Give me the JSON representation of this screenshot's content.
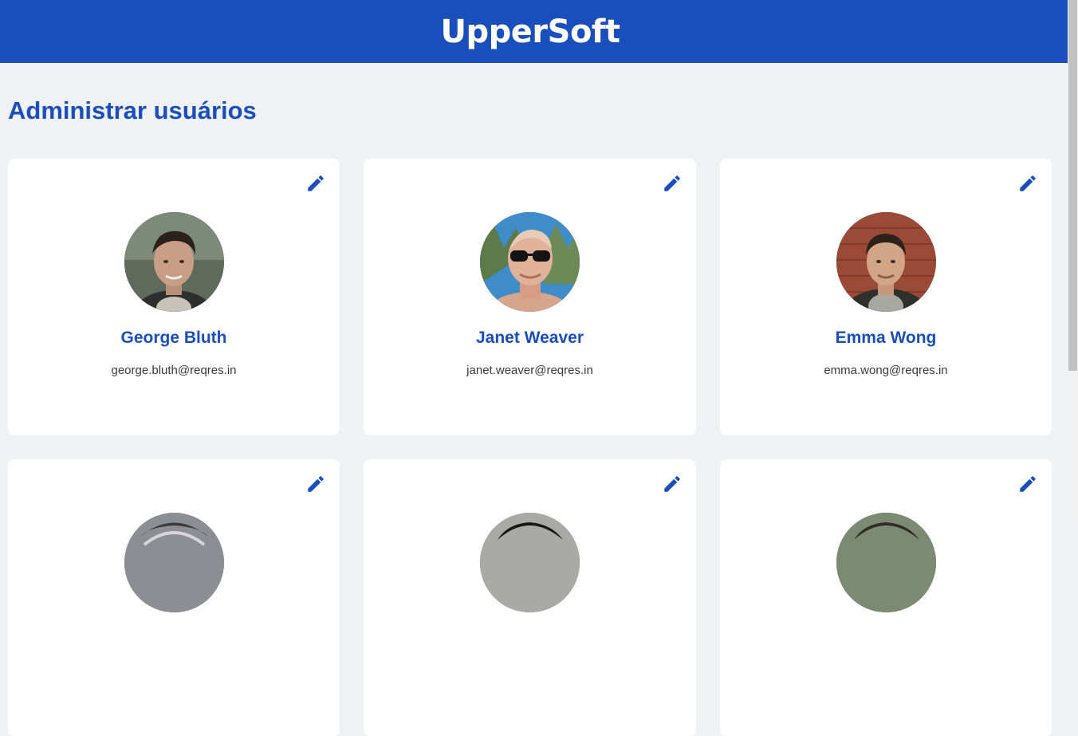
{
  "app": {
    "logo": "UpperSoft"
  },
  "colors": {
    "brand": "#1a4ebd",
    "background": "#f0f1f3",
    "card": "#ffffff"
  },
  "page": {
    "title": "Administrar usuários"
  },
  "users": [
    {
      "name": "George Bluth",
      "email": "george.bluth@reqres.in",
      "edit_icon": "pencil-icon",
      "avatar": "user-photo"
    },
    {
      "name": "Janet Weaver",
      "email": "janet.weaver@reqres.in",
      "edit_icon": "pencil-icon",
      "avatar": "user-photo"
    },
    {
      "name": "Emma Wong",
      "email": "emma.wong@reqres.in",
      "edit_icon": "pencil-icon",
      "avatar": "user-photo"
    },
    {
      "name": "",
      "email": "",
      "edit_icon": "pencil-icon",
      "avatar": "user-photo"
    },
    {
      "name": "",
      "email": "",
      "edit_icon": "pencil-icon",
      "avatar": "user-photo"
    },
    {
      "name": "",
      "email": "",
      "edit_icon": "pencil-icon",
      "avatar": "user-photo"
    }
  ]
}
